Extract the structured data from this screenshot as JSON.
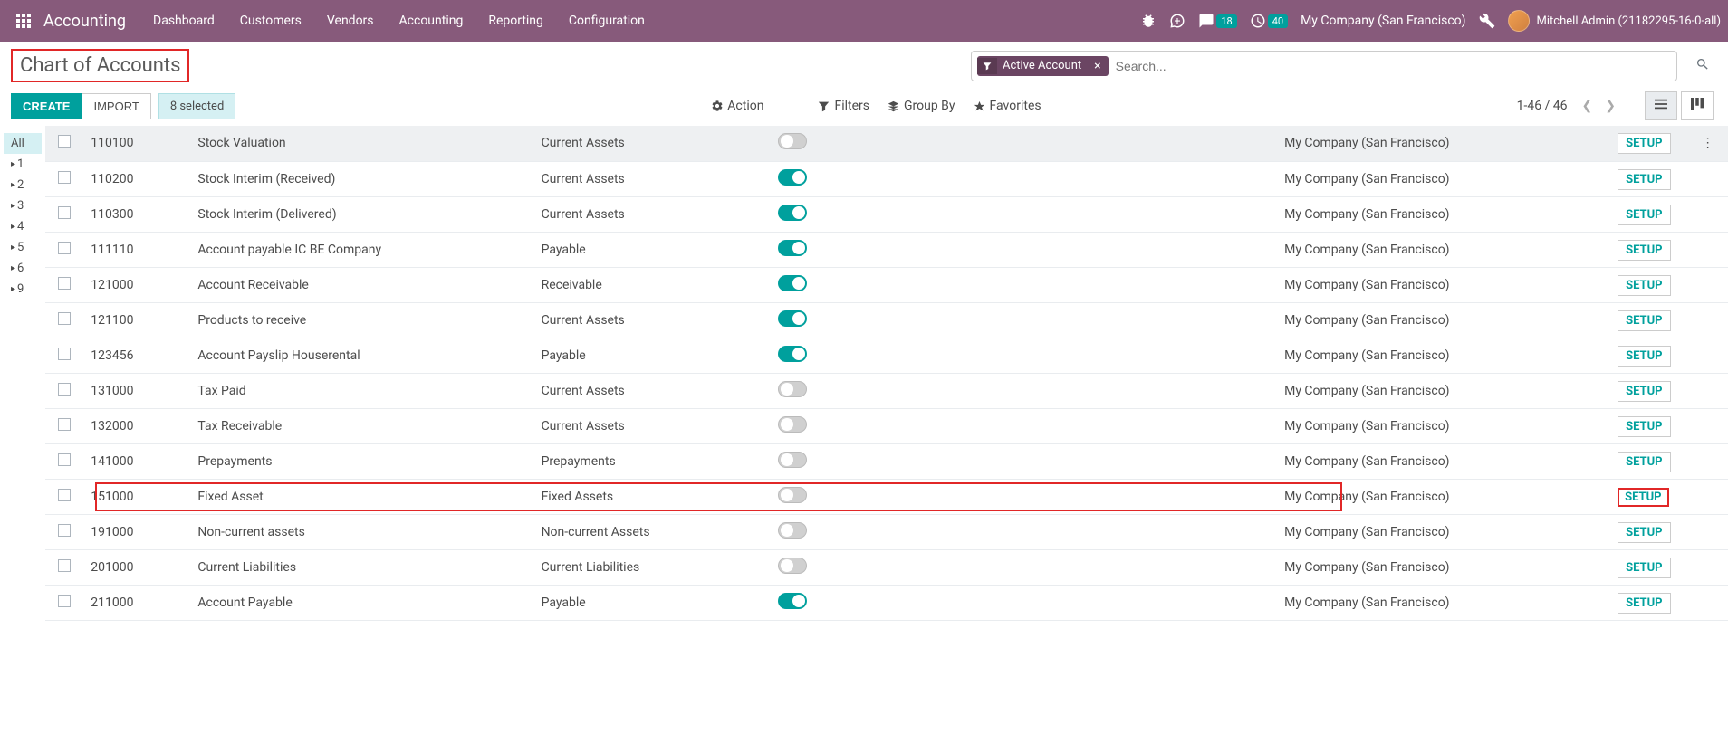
{
  "navbar": {
    "app_name": "Accounting",
    "menu": [
      "Dashboard",
      "Customers",
      "Vendors",
      "Accounting",
      "Reporting",
      "Configuration"
    ],
    "messages_badge": "18",
    "activities_badge": "40",
    "company": "My Company (San Francisco)",
    "user": "Mitchell Admin (21182295-16-0-all)"
  },
  "breadcrumb": "Chart of Accounts",
  "search": {
    "facet_label": "Active Account",
    "placeholder": "Search..."
  },
  "buttons": {
    "create": "CREATE",
    "import": "IMPORT",
    "selection": "8 selected",
    "action": "Action",
    "filters": "Filters",
    "group_by": "Group By",
    "favorites": "Favorites",
    "setup": "SETUP"
  },
  "pager": "1-46 / 46",
  "sidebar": {
    "all": "All",
    "groups": [
      "1",
      "2",
      "3",
      "4",
      "5",
      "6",
      "9"
    ]
  },
  "rows": [
    {
      "code": "110100",
      "name": "Stock Valuation",
      "type": "Current Assets",
      "reconcile": false,
      "company": "My Company (San Francisco)"
    },
    {
      "code": "110200",
      "name": "Stock Interim (Received)",
      "type": "Current Assets",
      "reconcile": true,
      "company": "My Company (San Francisco)"
    },
    {
      "code": "110300",
      "name": "Stock Interim (Delivered)",
      "type": "Current Assets",
      "reconcile": true,
      "company": "My Company (San Francisco)"
    },
    {
      "code": "111110",
      "name": "Account payable IC BE Company",
      "type": "Payable",
      "reconcile": true,
      "company": "My Company (San Francisco)"
    },
    {
      "code": "121000",
      "name": "Account Receivable",
      "type": "Receivable",
      "reconcile": true,
      "company": "My Company (San Francisco)"
    },
    {
      "code": "121100",
      "name": "Products to receive",
      "type": "Current Assets",
      "reconcile": true,
      "company": "My Company (San Francisco)"
    },
    {
      "code": "123456",
      "name": "Account Payslip Houserental",
      "type": "Payable",
      "reconcile": true,
      "company": "My Company (San Francisco)"
    },
    {
      "code": "131000",
      "name": "Tax Paid",
      "type": "Current Assets",
      "reconcile": false,
      "company": "My Company (San Francisco)"
    },
    {
      "code": "132000",
      "name": "Tax Receivable",
      "type": "Current Assets",
      "reconcile": false,
      "company": "My Company (San Francisco)"
    },
    {
      "code": "141000",
      "name": "Prepayments",
      "type": "Prepayments",
      "reconcile": false,
      "company": "My Company (San Francisco)"
    },
    {
      "code": "151000",
      "name": "Fixed Asset",
      "type": "Fixed Assets",
      "reconcile": false,
      "company": "My Company (San Francisco)",
      "highlighted": true
    },
    {
      "code": "191000",
      "name": "Non-current assets",
      "type": "Non-current Assets",
      "reconcile": false,
      "company": "My Company (San Francisco)"
    },
    {
      "code": "201000",
      "name": "Current Liabilities",
      "type": "Current Liabilities",
      "reconcile": false,
      "company": "My Company (San Francisco)"
    },
    {
      "code": "211000",
      "name": "Account Payable",
      "type": "Payable",
      "reconcile": true,
      "company": "My Company (San Francisco)"
    }
  ]
}
